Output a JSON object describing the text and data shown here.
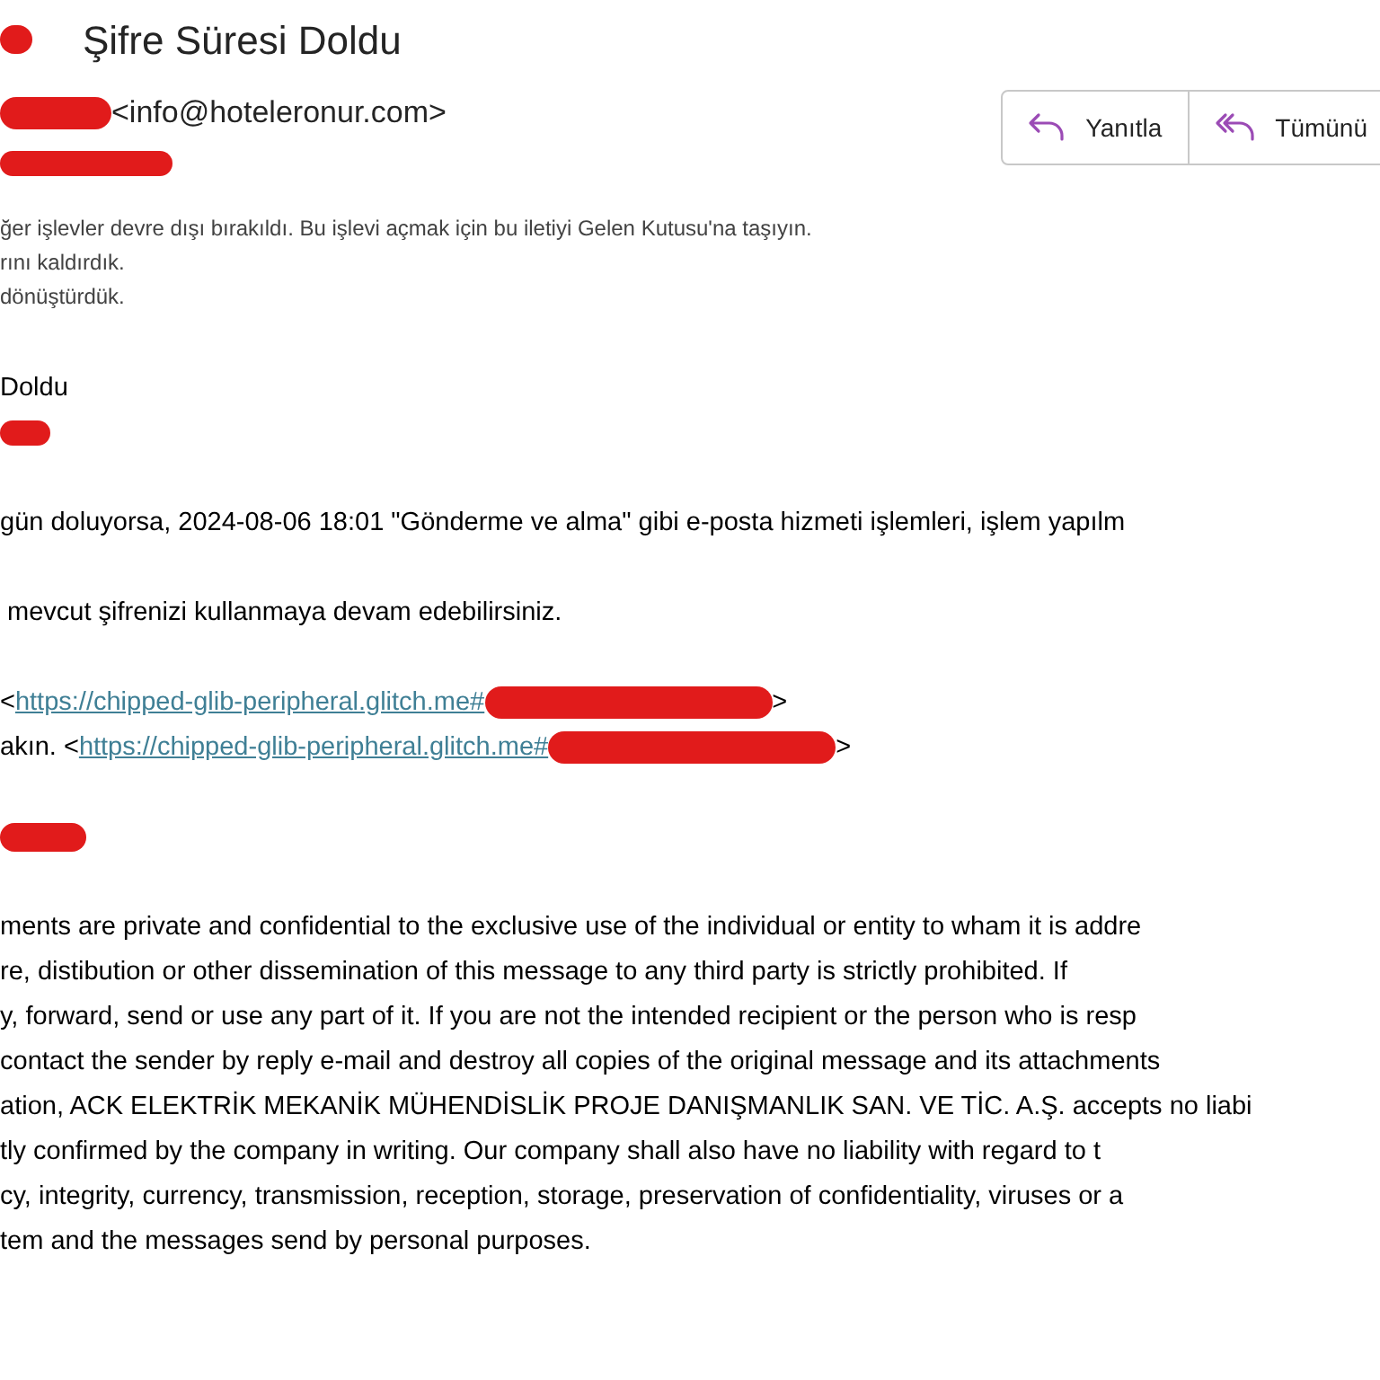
{
  "header": {
    "subject": "Şifre Süresi Doldu",
    "sender_email": "<info@hoteleronur.com>"
  },
  "actions": [
    {
      "label": "Yanıtla",
      "kind": "reply"
    },
    {
      "label": "Tümünü",
      "kind": "reply_all"
    }
  ],
  "notices": [
    "ğer işlevler devre dışı bırakıldı. Bu işlevi açmak için bu iletiyi Gelen Kutusu'na taşıyın.",
    "rını kaldırdık.",
    "dönüştürdük."
  ],
  "paragraphs": [
    [
      [
        {
          "kind": "text",
          "text": "Doldu"
        }
      ],
      [
        {
          "kind": "redaction"
        }
      ]
    ],
    [
      [
        {
          "kind": "text",
          "text": "gün doluyorsa, 2024-08-06 18:01 \"Gönderme ve alma\" gibi e-posta hizmeti işlemleri, işlem yapılm"
        }
      ]
    ],
    [
      [
        {
          "kind": "text",
          "text": "mevcut şifrenizi kullanmaya devam edebilirsiniz."
        }
      ]
    ],
    [
      [
        {
          "kind": "text",
          "text": "<"
        },
        {
          "kind": "link",
          "text": "https://chipped-glib-peripheral.glitch.me#"
        },
        {
          "kind": "redaction"
        },
        {
          "kind": "text",
          "text": ">"
        }
      ],
      [
        {
          "kind": "text",
          "text": "akın. <"
        },
        {
          "kind": "link",
          "text": "https://chipped-glib-peripheral.glitch.me#"
        },
        {
          "kind": "redaction"
        },
        {
          "kind": "text",
          "text": ">"
        }
      ]
    ],
    [
      [
        {
          "kind": "redaction"
        }
      ]
    ],
    [
      [
        {
          "kind": "text",
          "text": "ments are private and confidential to the exclusive use of the individual or entity to wham it is addre"
        }
      ],
      [
        {
          "kind": "text",
          "text": "re, distibution or other dissemination of this message to any third party is strictly prohibited. If"
        }
      ],
      [
        {
          "kind": "text",
          "text": "y, forward, send or use any part of it. If you are not the intended recipient or the person who is resp"
        }
      ],
      [
        {
          "kind": "text",
          "text": "contact the sender by reply e-mail and destroy all copies of the original message and its attachments"
        }
      ],
      [
        {
          "kind": "text",
          "text": "ation, ACK ELEKTRİK MEKANİK MÜHENDİSLİK PROJE DANIŞMANLIK SAN. VE TİC. A.Ş. accepts no liabi"
        }
      ],
      [
        {
          "kind": "text",
          "text": "tly confirmed by the company in writing. Our company shall also have no liability with regard to t"
        }
      ],
      [
        {
          "kind": "text",
          "text": "cy, integrity, currency, transmission, reception, storage, preservation of confidentiality, viruses or a"
        }
      ],
      [
        {
          "kind": "text",
          "text": "tem and the messages send by personal purposes."
        }
      ]
    ]
  ]
}
